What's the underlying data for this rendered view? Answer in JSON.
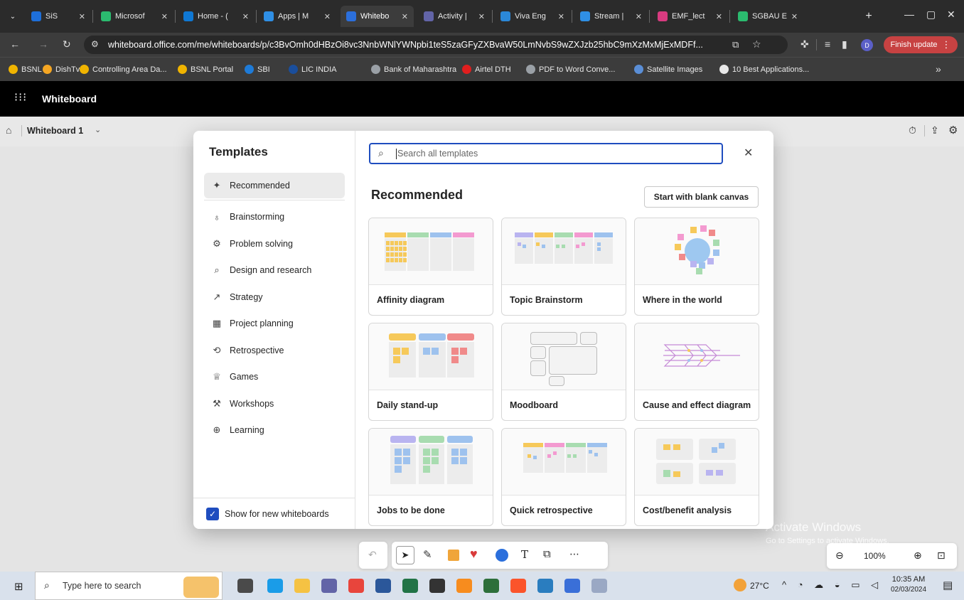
{
  "browser": {
    "tabs": [
      {
        "label": "SiS",
        "color": "#1e6fd9"
      },
      {
        "label": "Microsof",
        "color": "#2bbb6f"
      },
      {
        "label": "Home - (",
        "color": "#0f78d4"
      },
      {
        "label": "Apps | M",
        "color": "#2f8fe5"
      },
      {
        "label": "Whitebo",
        "color": "#2b6fdc",
        "active": true
      },
      {
        "label": "Activity |",
        "color": "#6264a7"
      },
      {
        "label": "Viva Eng",
        "color": "#2b88d8"
      },
      {
        "label": "Stream |",
        "color": "#2f8fe5"
      },
      {
        "label": "EMF_lect",
        "color": "#d83b80"
      },
      {
        "label": "SGBAU E",
        "color": "#2bbb6f"
      }
    ],
    "url": "whiteboard.office.com/me/whiteboards/p/c3BvOmh0dHBzOi8vc3NnbWNlYWNpbi1teS5zaGFyZXBvaW50LmNvbS9wZXJzb25hbC9mXzMxMjExMDFf...",
    "profile": "D",
    "finish_update": "Finish update",
    "bookmarks": [
      {
        "label": "BSNL",
        "color": "#f0b400"
      },
      {
        "label": "DishTv",
        "color": "#f5a623"
      },
      {
        "label": "Controlling Area Da...",
        "color": "#f0b400"
      },
      {
        "label": "BSNL Portal",
        "color": "#f0b400"
      },
      {
        "label": "SBI",
        "color": "#1e7bd8"
      },
      {
        "label": "LIC INDIA",
        "color": "#1a4e9c"
      },
      {
        "label": "Bank of Maharashtra",
        "color": "#9aa0a6"
      },
      {
        "label": "Airtel DTH",
        "color": "#e01e1e"
      },
      {
        "label": "PDF to Word Conve...",
        "color": "#9aa0a6"
      },
      {
        "label": "Satellite Images",
        "color": "#5a8ed6"
      },
      {
        "label": "10 Best Applications...",
        "color": "#e8e8e8"
      }
    ]
  },
  "app": {
    "title": "Whiteboard",
    "whiteboard_name": "Whiteboard 1"
  },
  "dialog": {
    "heading": "Templates",
    "categories": [
      {
        "label": "Recommended",
        "icon": "sparkle-icon",
        "glyph": "✦"
      },
      {
        "label": "Brainstorming",
        "icon": "lightbulb-icon",
        "glyph": "♁"
      },
      {
        "label": "Problem solving",
        "icon": "puzzle-icon",
        "glyph": "⚙"
      },
      {
        "label": "Design and research",
        "icon": "search-icon",
        "glyph": "⌕"
      },
      {
        "label": "Strategy",
        "icon": "trend-icon",
        "glyph": "↗"
      },
      {
        "label": "Project planning",
        "icon": "calendar-icon",
        "glyph": "▦"
      },
      {
        "label": "Retrospective",
        "icon": "retro-icon",
        "glyph": "⟲"
      },
      {
        "label": "Games",
        "icon": "trophy-icon",
        "glyph": "♕"
      },
      {
        "label": "Workshops",
        "icon": "wrench-icon",
        "glyph": "⚒"
      },
      {
        "label": "Learning",
        "icon": "globe-icon",
        "glyph": "⊕"
      }
    ],
    "show_for_new": "Show for new whiteboards",
    "search_placeholder": "Search all templates",
    "section_title": "Recommended",
    "blank_canvas": "Start with blank canvas",
    "templates": [
      {
        "label": "Affinity diagram"
      },
      {
        "label": "Topic Brainstorm"
      },
      {
        "label": "Where in the world"
      },
      {
        "label": "Daily stand-up"
      },
      {
        "label": "Moodboard"
      },
      {
        "label": "Cause and effect diagram"
      },
      {
        "label": "Jobs to be done"
      },
      {
        "label": "Quick retrospective"
      },
      {
        "label": "Cost/benefit analysis"
      }
    ]
  },
  "watermark": {
    "title": "Activate Windows",
    "subtitle": "Go to Settings to activate Windows."
  },
  "zoom": {
    "level": "100%"
  },
  "taskbar": {
    "search_placeholder": "Type here to search",
    "weather": "27°C",
    "time": "10:35 AM",
    "date": "02/03/2024"
  }
}
